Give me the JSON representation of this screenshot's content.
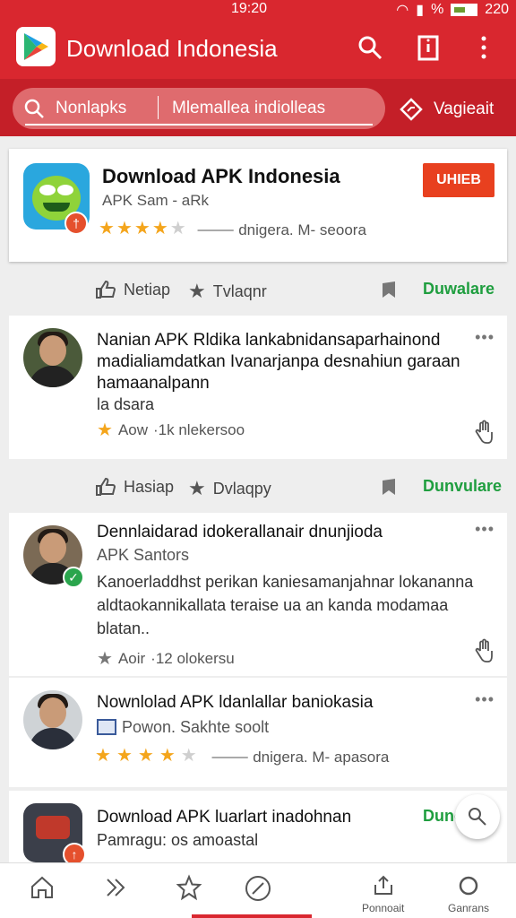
{
  "status": {
    "time": "19:20",
    "battery": "220"
  },
  "app": {
    "title": "Download Indonesia"
  },
  "search": {
    "placeholder": "Nonlapks",
    "placeholder2": "Mlemallea indiolleas",
    "navigate_label": "Vagieait"
  },
  "featured": {
    "title": "Download APK Indonesia",
    "subtitle": "APK Sam - aRk",
    "rating": 4,
    "meta": "⸻ dnigera. M- seoora",
    "install_label": "UHIEB",
    "badge": "†"
  },
  "actions1": {
    "like": "Netiap",
    "fav": "Tvlaqnr",
    "download": "Duwalare"
  },
  "post1": {
    "title": "Nanian APK Rldika lankabnidansaparhainond madialiamdatkan Ivanarjanpa desnahiun garaan hamaanalpann",
    "text": "la dsara",
    "foot_label": "Aow",
    "foot_meta": "·1k nlekersoo"
  },
  "actions2": {
    "like": "Hasiap",
    "fav": "Dvlaqpy",
    "download": "Dunvulare"
  },
  "post2": {
    "title": "Dennlaidarad idokerallanair dnunjioda",
    "subtitle": "APK Santors",
    "text": "Kanoerladdhst perikan kaniesamanjahnar lokananna aldtaokannikallata teraise ua an kanda modamaa blatan..",
    "foot_label": "Aoir",
    "foot_meta": "·12 olokersu"
  },
  "post3": {
    "title": "Nownlolad APK ldanlallar baniokasia",
    "subtitle": "Powon. Sakhte soolt",
    "rating": 4,
    "meta": "⸻ dnigera. M- apasora"
  },
  "post4": {
    "title": "Download APK luarlart inadohnan",
    "subtitle": "Pamragu: os amoastal",
    "action": "Duncl"
  },
  "nav": {
    "label4": "Ponnoait",
    "label5": "Ganrans"
  },
  "colors": {
    "primary": "#d9272f",
    "accent_green": "#1f9e3f",
    "install": "#e8401f",
    "star": "#f4a51c"
  },
  "icons": [
    "play-store-logo-icon",
    "search-icon",
    "info-icon",
    "more-vert-icon",
    "navigate-icon",
    "thumbs-up-icon",
    "star-icon",
    "bookmark-icon",
    "hand-icon",
    "home-icon",
    "forward-icon",
    "compass-icon",
    "share-icon",
    "refresh-icon"
  ]
}
